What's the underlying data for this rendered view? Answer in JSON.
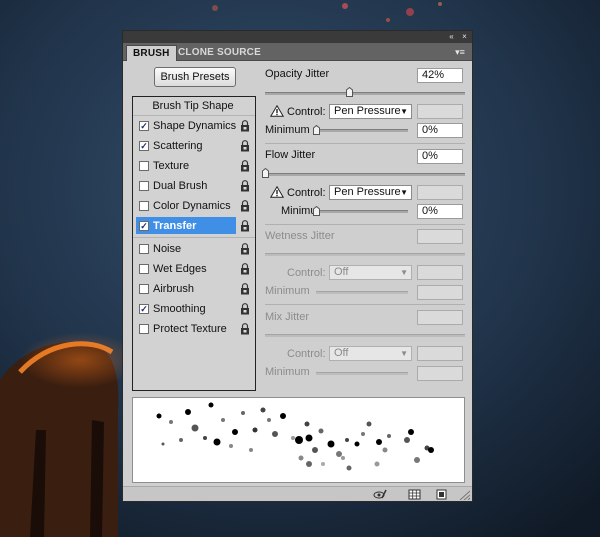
{
  "tabs": [
    {
      "label": "BRUSH"
    },
    {
      "label": "CLONE SOURCE"
    }
  ],
  "titlebar": {
    "collapse_icon": "«",
    "close_icon": "×"
  },
  "menu_icon": "▾≡",
  "brush_presets_label": "Brush Presets",
  "sidebar": {
    "header": "Brush Tip Shape",
    "items": [
      {
        "label": "Shape Dynamics",
        "checked": true
      },
      {
        "label": "Scattering",
        "checked": true
      },
      {
        "label": "Texture",
        "checked": false
      },
      {
        "label": "Dual Brush",
        "checked": false
      },
      {
        "label": "Color Dynamics",
        "checked": false
      },
      {
        "label": "Transfer",
        "checked": true,
        "selected": true
      },
      {
        "label": "Noise",
        "checked": false
      },
      {
        "label": "Wet Edges",
        "checked": false
      },
      {
        "label": "Airbrush",
        "checked": false
      },
      {
        "label": "Smoothing",
        "checked": true
      },
      {
        "label": "Protect Texture",
        "checked": false
      }
    ]
  },
  "opacity_jitter": {
    "label": "Opacity Jitter",
    "value": "42%",
    "level": 42,
    "control_label": "Control:",
    "control_value": "Pen Pressure",
    "minimum_label": "Minimum",
    "minimum_value": "0%"
  },
  "flow_jitter": {
    "label": "Flow Jitter",
    "value": "0%",
    "level": 0,
    "control_label": "Control:",
    "control_value": "Pen Pressure",
    "minimum_label": "Minimu",
    "minimum_value": "0%"
  },
  "wetness_jitter": {
    "label": "Wetness Jitter",
    "control_label": "Control:",
    "control_value": "Off",
    "minimum_label": "Minimum"
  },
  "mix_jitter": {
    "label": "Mix Jitter",
    "control_label": "Control:",
    "control_value": "Off",
    "minimum_label": "Minimum"
  },
  "colors": {
    "selection": "#3f8fe6",
    "panel": "#cfcfcf",
    "tabbar": "#636363"
  },
  "icons": [
    "lock-icon",
    "warning-icon",
    "eye-brush-icon",
    "grid-icon",
    "new-preset-icon",
    "resize-grip-icon"
  ]
}
